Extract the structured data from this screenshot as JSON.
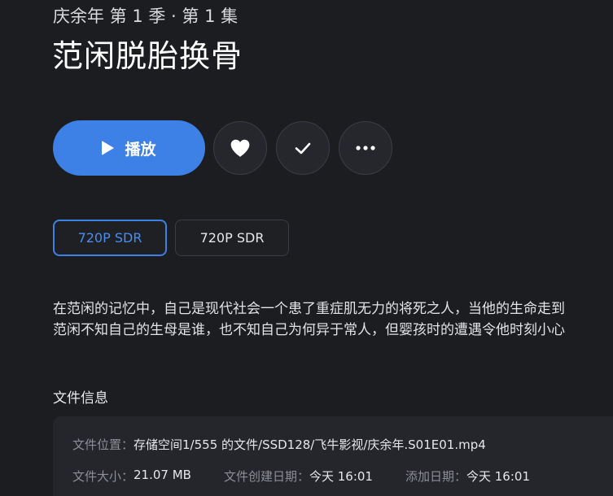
{
  "header": {
    "subtitle": "庆余年 第 1 季 · 第 1 集",
    "title": "范闲脱胎换骨"
  },
  "actions": {
    "play_label": "播放",
    "icons": [
      "play-icon",
      "heart-icon",
      "check-icon",
      "more-icon"
    ],
    "accent_color": "#3d80e6"
  },
  "versions": [
    {
      "label": "720P SDR",
      "selected": true
    },
    {
      "label": "720P SDR",
      "selected": false
    }
  ],
  "description": {
    "line1": "在范闲的记忆中，自己是现代社会一个患了重症肌无力的将死之人，当他的生命走到",
    "line2": "范闲不知自己的生母是谁，也不知自己为何异于常人，但婴孩时的遭遇令他时刻小心"
  },
  "file_info": {
    "section_title": "文件信息",
    "location_label": "文件位置：",
    "location_value": "存储空间1/555 的文件/SSD128/飞牛影视/庆余年.S01E01.mp4",
    "size_label": "文件大小：",
    "size_value": "21.07 MB",
    "created_label": "文件创建日期：",
    "created_value": "今天 16:01",
    "added_label": "添加日期：",
    "added_value": "今天 16:01"
  }
}
